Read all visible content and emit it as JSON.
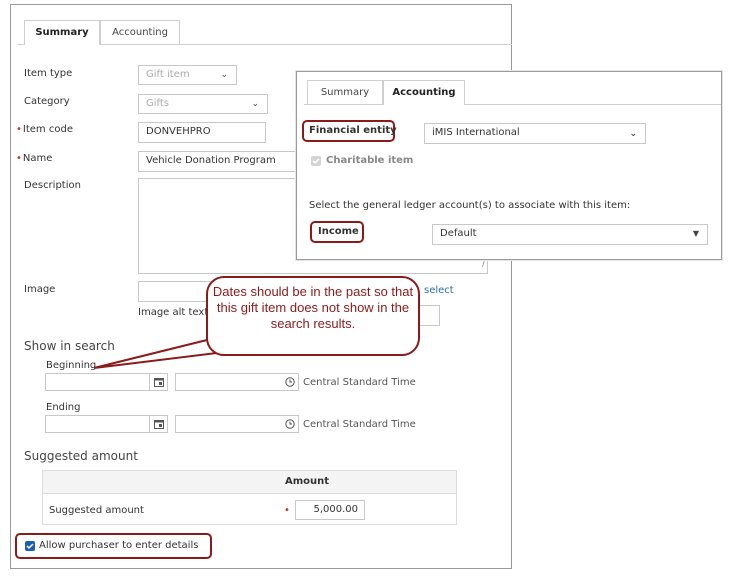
{
  "summary_panel": {
    "tabs": [
      "Summary",
      "Accounting"
    ],
    "item_type": {
      "label": "Item type",
      "value": "Gift item"
    },
    "category": {
      "label": "Category",
      "value": "Gifts"
    },
    "item_code": {
      "label": "Item code",
      "value": "DONVEHPRO"
    },
    "name": {
      "label": "Name",
      "value": "Vehicle Donation Program"
    },
    "description": {
      "label": "Description",
      "value": ""
    },
    "image": {
      "label": "Image",
      "select_link": "select",
      "alt_label": "Image alt text"
    },
    "show_in_search": {
      "title": "Show in search",
      "beginning_label": "Beginning",
      "ending_label": "Ending",
      "timezone": "Central Standard Time"
    },
    "suggested_amount": {
      "title": "Suggested amount",
      "column_header": "Amount",
      "row_label": "Suggested amount",
      "value": "5,000.00"
    },
    "allow_purchaser": {
      "label": "Allow purchaser to enter details",
      "checked": true
    }
  },
  "accounting_panel": {
    "tabs": [
      "Summary",
      "Accounting"
    ],
    "financial_entity": {
      "label": "Financial entity",
      "value": "iMIS International"
    },
    "charitable_item": {
      "label": "Charitable item",
      "checked": true
    },
    "gl_instruction": "Select the general ledger account(s) to associate with this item:",
    "income": {
      "label": "Income",
      "value": "Default"
    }
  },
  "callout_text": "Dates should be in the past so that this gift item does not show in the search results.",
  "colors": {
    "highlight": "#8b1a1a",
    "checkbox": "#1a5fb4",
    "link": "#2a6fa8"
  }
}
